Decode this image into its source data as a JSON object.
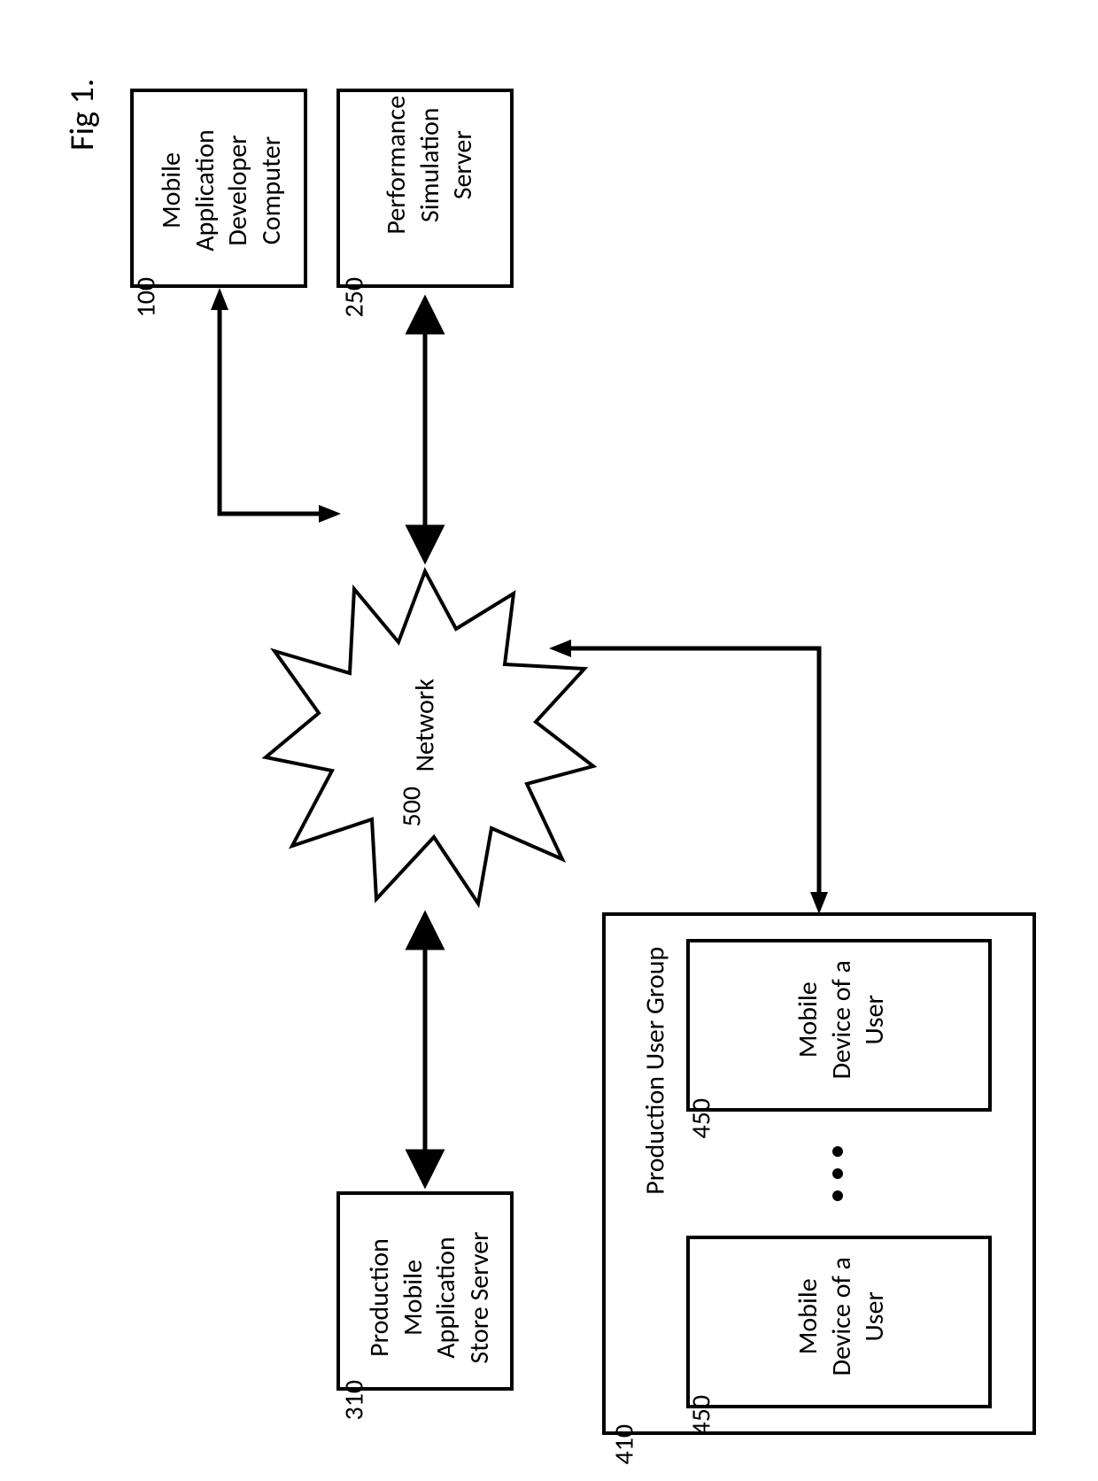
{
  "figure_label": "Fig 1.",
  "boxes": {
    "dev": {
      "lines": "Mobile\nApplication\nDeveloper\nComputer",
      "ref": "100"
    },
    "sim": {
      "lines": "Performance\nSimulation\nServer",
      "ref": "250"
    },
    "store": {
      "lines": "Production\nMobile\nApplication\nStore Server",
      "ref": "310"
    },
    "group_title": "Production User Group",
    "group_ref": "410",
    "device": {
      "lines": "Mobile\nDevice of a\nUser",
      "ref": "450"
    }
  },
  "network": {
    "label": "Network",
    "ref": "500"
  }
}
